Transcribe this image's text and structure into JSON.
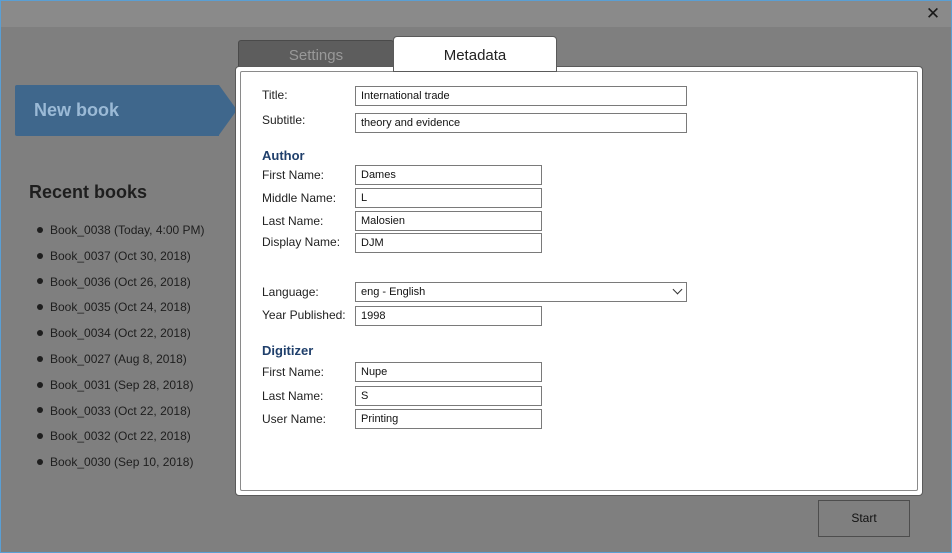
{
  "window": {
    "close_glyph": "✕"
  },
  "sidebar": {
    "new_book_label": "New book",
    "recent_title": "Recent books",
    "recent_items": [
      "Book_0038 (Today, 4:00 PM)",
      "Book_0037 (Oct 30, 2018)",
      "Book_0036 (Oct 26, 2018)",
      "Book_0035 (Oct 24, 2018)",
      "Book_0034 (Oct 22, 2018)",
      "Book_0027 (Aug 8, 2018)",
      "Book_0031 (Sep 28, 2018)",
      "Book_0033 (Oct 22, 2018)",
      "Book_0032 (Oct 22, 2018)",
      "Book_0030 (Sep 10, 2018)"
    ]
  },
  "tabs": {
    "settings": "Settings",
    "metadata": "Metadata"
  },
  "form": {
    "title_label": "Title:",
    "title_value": "International trade",
    "subtitle_label": "Subtitle:",
    "subtitle_value": "theory and evidence",
    "author_heading": "Author",
    "author_first_label": "First Name:",
    "author_first_value": "Dames",
    "author_middle_label": "Middle Name:",
    "author_middle_value": "L",
    "author_last_label": "Last Name:",
    "author_last_value": "Malosien",
    "author_display_label": "Display Name:",
    "author_display_value": "DJM",
    "language_label": "Language:",
    "language_value": "eng - English",
    "year_label": "Year Published:",
    "year_value": "1998",
    "digitizer_heading": "Digitizer",
    "dig_first_label": "First Name:",
    "dig_first_value": "Nupe",
    "dig_last_label": "Last Name:",
    "dig_last_value": "S",
    "dig_user_label": "User Name:",
    "dig_user_value": "Printing"
  },
  "footer": {
    "start_label": "Start"
  },
  "colors": {
    "accent": "#3f678c",
    "heading": "#1f3f6b",
    "background": "#7f7f7f"
  }
}
